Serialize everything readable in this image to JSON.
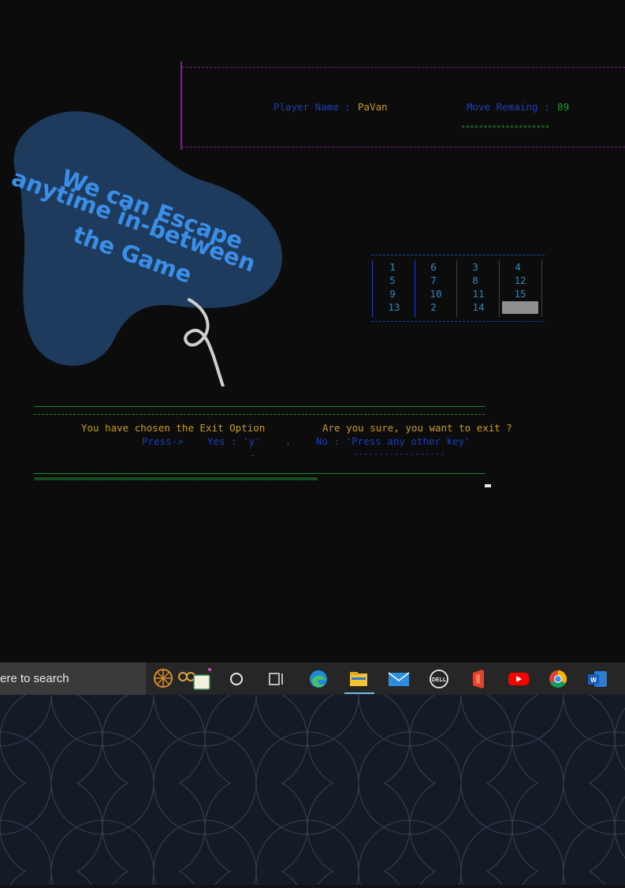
{
  "header": {
    "player_label": "Player Name : ",
    "player_name": "PaVan",
    "moves_label": "Move Remaing : ",
    "moves_value": "89",
    "moves_bar": "********************"
  },
  "callout": {
    "line1": "We can Escape",
    "line2": "anytime in-between",
    "line3": "the Game"
  },
  "puzzle": {
    "rows": [
      [
        "1",
        "6",
        "3",
        "4"
      ],
      [
        "5",
        "7",
        "8",
        "12"
      ],
      [
        "9",
        "10",
        "11",
        "15"
      ],
      [
        "13",
        "2",
        "14",
        ""
      ]
    ]
  },
  "exit_dialog": {
    "message": "You have chosen the Exit Option",
    "question": "Are you sure, you want to exit ?",
    "press_label": "Press->",
    "yes_label": "Yes : 'y'",
    "separator": ",",
    "no_label": "No : 'Press any other key'",
    "yes_underline": "-",
    "no_underline": "------------------",
    "bottom_rule": "========================================================================="
  },
  "taskbar": {
    "search_placeholder": "ere to search",
    "icons": [
      "cortana-icon",
      "task-view-icon",
      "edge-icon",
      "file-explorer-icon",
      "mail-icon",
      "dell-icon",
      "office-icon",
      "youtube-icon",
      "chrome-icon",
      "word-icon"
    ]
  },
  "colors": {
    "console_bg": "#0c0c0c",
    "border_magenta": "#7c1e8a",
    "text_blue": "#1a3fb8",
    "text_gold": "#c99a1c",
    "text_green": "#1f9a2e",
    "callout_blob": "#1e3a5c",
    "callout_text": "#3b8ee8"
  }
}
